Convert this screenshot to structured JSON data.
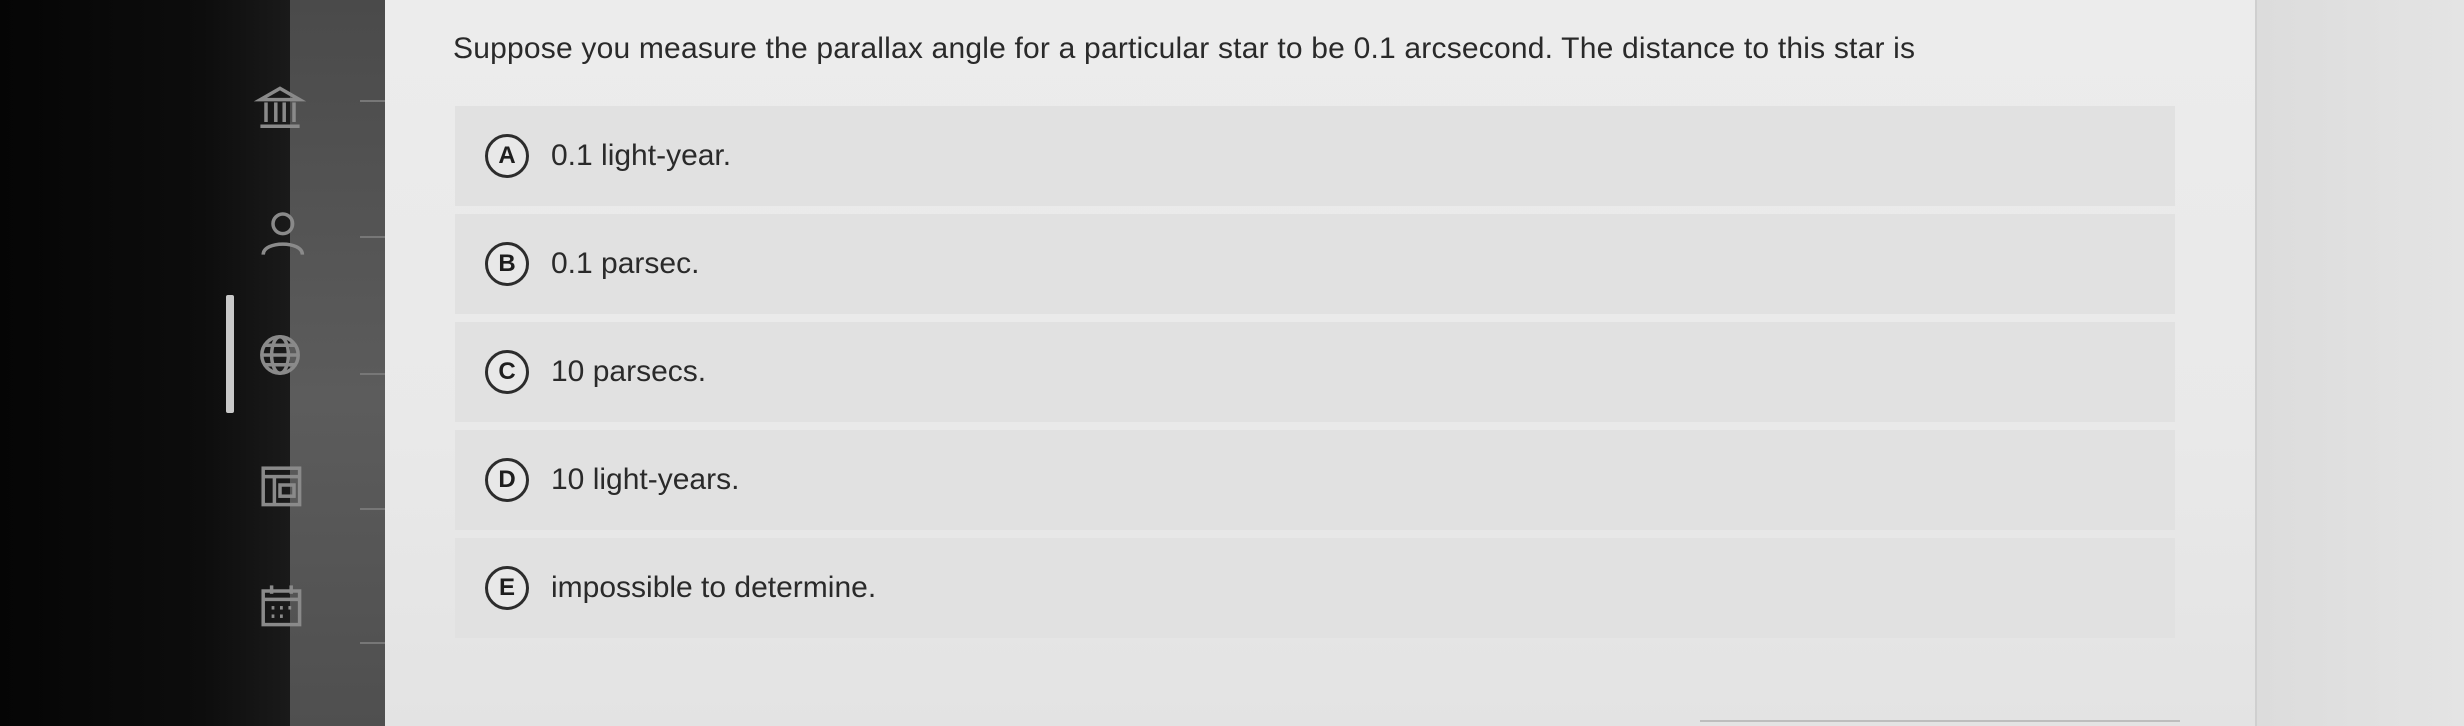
{
  "question": {
    "text": "Suppose you measure the parallax angle for a particular star to be 0.1 arcsecond. The distance to this star is"
  },
  "options": [
    {
      "letter": "A",
      "text": "0.1 light-year."
    },
    {
      "letter": "B",
      "text": "0.1 parsec."
    },
    {
      "letter": "C",
      "text": "10 parsecs."
    },
    {
      "letter": "D",
      "text": "10 light-years."
    },
    {
      "letter": "E",
      "text": "impossible to determine."
    }
  ],
  "nav": {
    "icons": [
      "institution-icon",
      "user-icon",
      "globe-icon",
      "book-icon",
      "calendar-icon"
    ]
  }
}
